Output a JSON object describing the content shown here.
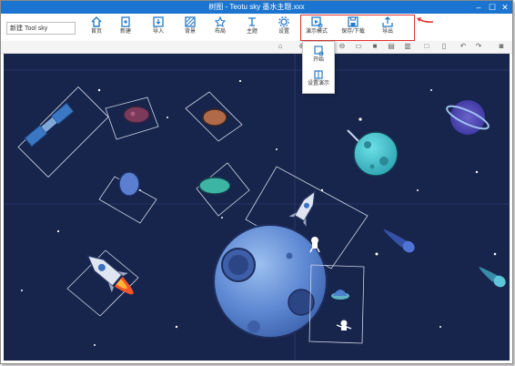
{
  "window": {
    "title": "树图 - Teotu sky 墨水主题.xxx",
    "controls": [
      "–",
      "☐",
      "✕"
    ]
  },
  "ribbon": {
    "doc_name": "新建 Tool sky",
    "buttons": [
      {
        "label": "首页",
        "icon": "home-icon"
      },
      {
        "label": "新建",
        "icon": "new-page-icon"
      },
      {
        "label": "导入",
        "icon": "import-icon"
      },
      {
        "label": "背景",
        "icon": "background-icon"
      },
      {
        "label": "布局",
        "icon": "layout-icon"
      },
      {
        "label": "主题",
        "icon": "theme-icon"
      },
      {
        "label": "设置",
        "icon": "settings-icon"
      },
      {
        "label": "演示模式",
        "icon": "presentation-icon"
      },
      {
        "label": "保存/下载",
        "icon": "save-icon"
      },
      {
        "label": "导出",
        "icon": "export-icon"
      }
    ]
  },
  "dropdown": {
    "items": [
      {
        "label": "开始",
        "icon": "slides-icon"
      },
      {
        "label": "设置演示",
        "icon": "presentation-settings-icon"
      }
    ]
  },
  "colors": {
    "titlebar": "#1b74cf",
    "canvas_bg": "#17244c",
    "highlight": "#e23232",
    "accent": "#1b74cf"
  }
}
